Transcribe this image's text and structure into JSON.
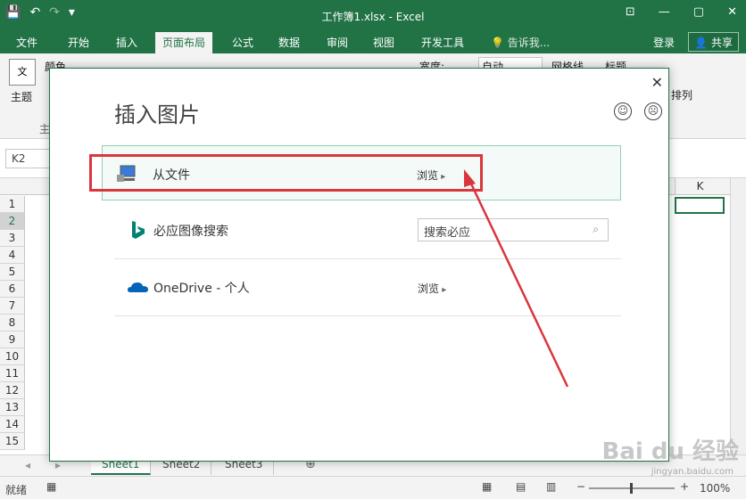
{
  "app": {
    "title": "工作簿1.xlsx - Excel",
    "window_buttons": [
      "⊡",
      "—",
      "▢",
      "✕"
    ],
    "qat": [
      "💾",
      "↶",
      "↷",
      "▾"
    ]
  },
  "tabs": [
    "文件",
    "开始",
    "插入",
    "页面布局",
    "公式",
    "数据",
    "审阅",
    "视图",
    "开发工具",
    "告诉我..."
  ],
  "active_tab": "页面布局",
  "account": {
    "login": "登录",
    "share": "共享"
  },
  "ribbon": {
    "theme": "主题",
    "colors": "颜色",
    "width_label": "宽度:",
    "width_value": "自动",
    "gridlines": "网格线",
    "headings": "标题",
    "arrange": "排列",
    "group_label": "主"
  },
  "formula_bar": {
    "name_box": "K2"
  },
  "grid": {
    "rows": [
      "1",
      "2",
      "3",
      "4",
      "5",
      "6",
      "7",
      "8",
      "9",
      "10",
      "11",
      "12",
      "13",
      "14",
      "15"
    ],
    "selected_row": "2",
    "visible_column": "K"
  },
  "sheets": [
    "Sheet1",
    "Sheet2",
    "Sheet3"
  ],
  "active_sheet": "Sheet1",
  "status": {
    "ready": "就绪",
    "zoom": "100%"
  },
  "dialog": {
    "title": "插入图片",
    "close": "✕",
    "feedback_icons": [
      "☺",
      "☹"
    ],
    "items": [
      {
        "label": "从文件",
        "action": "浏览"
      },
      {
        "label": "必应图像搜索",
        "search_placeholder": "搜索必应"
      },
      {
        "label": "OneDrive - 个人",
        "action": "浏览"
      }
    ]
  },
  "colors": {
    "excel_green": "#217346",
    "highlight_red": "#d9363e"
  },
  "watermark": {
    "brand": "Bai du 经验",
    "url": "jingyan.baidu.com"
  }
}
